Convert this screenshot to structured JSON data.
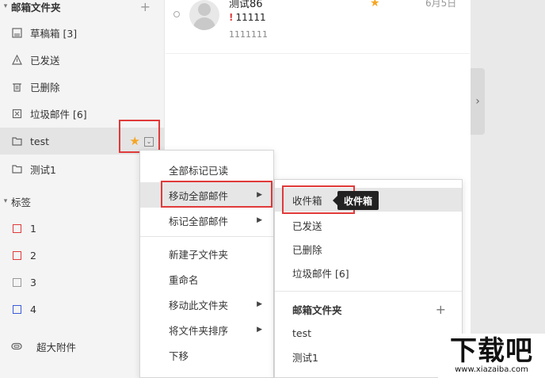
{
  "sidebar": {
    "mail_folders_header": "邮箱文件夹",
    "items": [
      {
        "label": "草稿箱 [3]",
        "icon": "draft-icon"
      },
      {
        "label": "已发送",
        "icon": "sent-icon"
      },
      {
        "label": "已删除",
        "icon": "trash-icon"
      },
      {
        "label": "垃圾邮件 [6]",
        "icon": "spam-icon"
      },
      {
        "label": "test",
        "icon": "folder-icon"
      },
      {
        "label": "测试1",
        "icon": "folder-icon"
      }
    ],
    "tags_header": "标签",
    "tags": [
      {
        "label": "1",
        "color": "#e03a3a"
      },
      {
        "label": "2",
        "color": "#e03a3a"
      },
      {
        "label": "3",
        "color": "#999999"
      },
      {
        "label": "4",
        "color": "#3a5bd9"
      }
    ],
    "attachments_label": "超大附件"
  },
  "mail": {
    "sender": "测试86",
    "subject": "11111",
    "preview": "1111111",
    "date": "6月5日"
  },
  "context_menu": {
    "items": [
      "全部标记已读",
      "移动全部邮件",
      "标记全部邮件",
      "新建子文件夹",
      "重命名",
      "移动此文件夹",
      "将文件夹排序",
      "下移"
    ]
  },
  "submenu": {
    "items": [
      "收件箱",
      "已发送",
      "已删除",
      "垃圾邮件 [6]"
    ],
    "folders_header": "邮箱文件夹",
    "folders": [
      "test",
      "测试1"
    ]
  },
  "tooltip": "收件箱",
  "watermark": {
    "text": "下载吧",
    "url": "www.xiazaiba.com"
  },
  "colors": {
    "accent_star": "#f5a623",
    "highlight_border": "#e03a3a"
  }
}
